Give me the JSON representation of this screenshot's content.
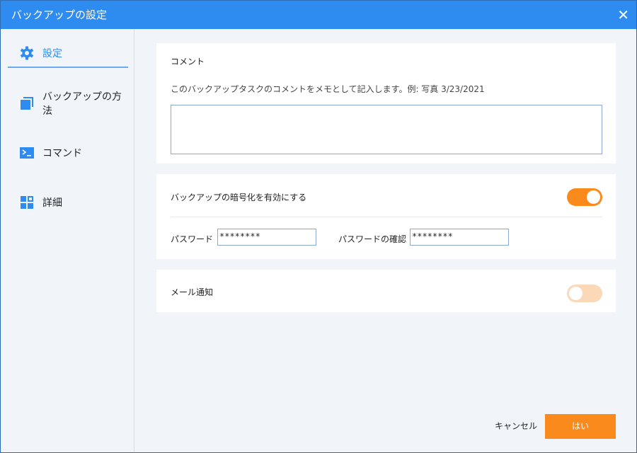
{
  "window": {
    "title": "バックアップの設定",
    "close_icon": "close-icon"
  },
  "sidebar": {
    "items": [
      {
        "label": "設定",
        "icon": "gear-icon",
        "active": true
      },
      {
        "label": "バックアップの方法",
        "icon": "copy-icon"
      },
      {
        "label": "コマンド",
        "icon": "terminal-icon"
      },
      {
        "label": "詳細",
        "icon": "grid-icon"
      }
    ]
  },
  "comment": {
    "title": "コメント",
    "description": "このバックアップタスクのコメントをメモとして記入します。例: 写真 3/23/2021",
    "value": ""
  },
  "encryption": {
    "label": "バックアップの暗号化を有効にする",
    "enabled": true,
    "password_label": "パスワード",
    "password_value": "********",
    "confirm_label": "パスワードの確認",
    "confirm_value": "********"
  },
  "email": {
    "label": "メール通知",
    "enabled": false
  },
  "footer": {
    "cancel": "キャンセル",
    "ok": "はい"
  },
  "colors": {
    "accent": "#2e8cf0",
    "orange": "#fb8a1d",
    "toggle_off": "#fbd8b8"
  }
}
